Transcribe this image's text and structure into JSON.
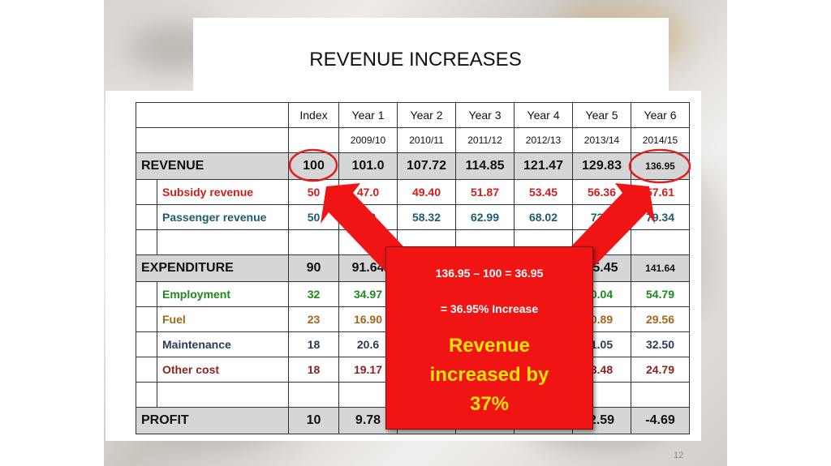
{
  "slide": {
    "title": "REVENUE INCREASES",
    "page_number": "12"
  },
  "table": {
    "header": {
      "index": "Index",
      "years": [
        "Year 1",
        "Year 2",
        "Year 3",
        "Year 4",
        "Year 5",
        "Year 6"
      ],
      "periods": [
        "2009/10",
        "2010/11",
        "2011/12",
        "2012/13",
        "2013/14",
        "2014/15"
      ]
    },
    "revenue": {
      "label": "REVENUE",
      "index": "100",
      "values": [
        "101.0",
        "107.72",
        "114.85",
        "121.47",
        "129.83",
        "136.95"
      ]
    },
    "subsidy": {
      "label": "Subsidy revenue",
      "index": "50",
      "values": [
        "47.0",
        "49.40",
        "51.87",
        "53.45",
        "56.36",
        "57.61"
      ]
    },
    "passenger": {
      "label": "Passenger revenue",
      "index": "50",
      "values": [
        "1.0",
        "58.32",
        "62.99",
        "68.02",
        "73.4",
        "79.34"
      ]
    },
    "expenditure": {
      "label": "EXPENDITURE",
      "index": "90",
      "values": [
        "91.64",
        "",
        "",
        "",
        "35.45",
        "141.64"
      ]
    },
    "employment": {
      "label": "Employment",
      "index": "32",
      "values": [
        "34.97",
        "",
        "",
        "",
        "0.04",
        "54.79"
      ]
    },
    "fuel": {
      "label": "Fuel",
      "index": "23",
      "values": [
        "16.90",
        "",
        "",
        "",
        "0.89",
        "29.56"
      ]
    },
    "maintenance": {
      "label": "Maintenance",
      "index": "18",
      "values": [
        "20.6",
        "",
        "",
        "",
        "1.05",
        "32.50"
      ]
    },
    "other": {
      "label": "Other cost",
      "index": "18",
      "values": [
        "19.17",
        "",
        "",
        "",
        "3.48",
        "24.79"
      ]
    },
    "profit": {
      "label": "PROFIT",
      "index": "10",
      "values": [
        "9.78",
        "",
        "",
        "",
        "2.59",
        "-4.69"
      ]
    }
  },
  "callout": {
    "calc": "136.95 – 100 = 36.95",
    "pct": "= 36.95% Increase",
    "headline": "Revenue increased by 37%"
  },
  "colors": {
    "callout_bg": "#f01414",
    "callout_headline": "#ffe600",
    "subsidy": "#d11c1c",
    "passenger": "#1e5b6e",
    "employment": "#1c8a1c",
    "fuel": "#a5651a",
    "maintenance": "#2b3a55",
    "other": "#8a2323",
    "negative": "#d11c1c"
  }
}
